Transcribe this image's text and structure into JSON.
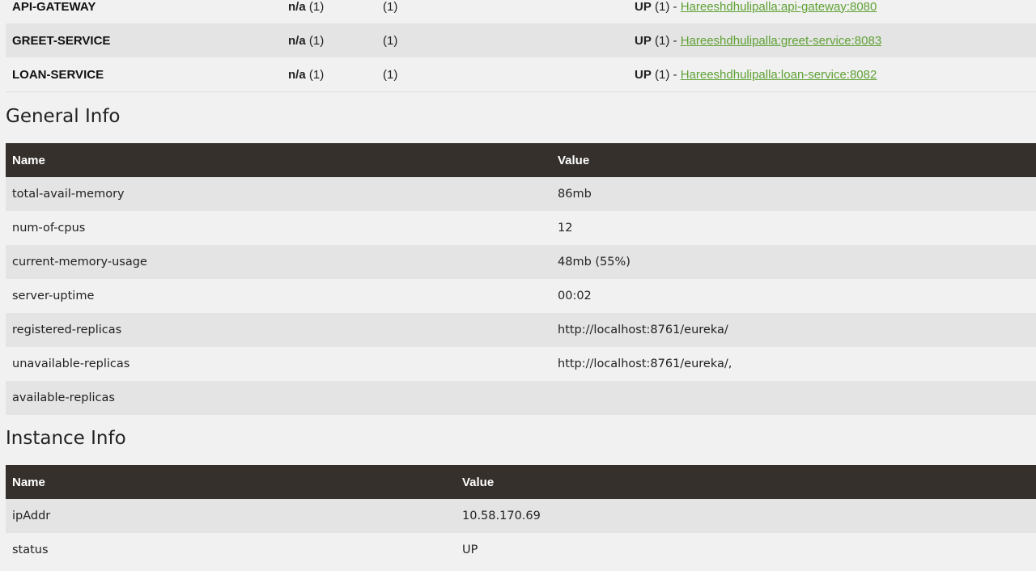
{
  "instances": [
    {
      "application": "API-GATEWAY",
      "ami_bold": "n/a",
      "ami_count": "(1)",
      "zones": "(1)",
      "status_prefix": "UP",
      "status_count": "(1) -",
      "status_link": "Hareeshdhulipalla:api-gateway:8080"
    },
    {
      "application": "GREET-SERVICE",
      "ami_bold": "n/a",
      "ami_count": "(1)",
      "zones": "(1)",
      "status_prefix": "UP",
      "status_count": "(1) -",
      "status_link": "Hareeshdhulipalla:greet-service:8083"
    },
    {
      "application": "LOAN-SERVICE",
      "ami_bold": "n/a",
      "ami_count": "(1)",
      "zones": "(1)",
      "status_prefix": "UP",
      "status_count": "(1) -",
      "status_link": "Hareeshdhulipalla:loan-service:8082"
    }
  ],
  "general_info": {
    "title": "General Info",
    "headers": {
      "name": "Name",
      "value": "Value"
    },
    "rows": [
      {
        "name": "total-avail-memory",
        "value": "86mb"
      },
      {
        "name": "num-of-cpus",
        "value": "12"
      },
      {
        "name": "current-memory-usage",
        "value": "48mb (55%)"
      },
      {
        "name": "server-uptime",
        "value": "00:02"
      },
      {
        "name": "registered-replicas",
        "value": "http://localhost:8761/eureka/"
      },
      {
        "name": "unavailable-replicas",
        "value": "http://localhost:8761/eureka/,"
      },
      {
        "name": "available-replicas",
        "value": ""
      }
    ]
  },
  "instance_info": {
    "title": "Instance Info",
    "headers": {
      "name": "Name",
      "value": "Value"
    },
    "rows": [
      {
        "name": "ipAddr",
        "value": "10.58.170.69"
      },
      {
        "name": "status",
        "value": "UP"
      }
    ]
  },
  "colors": {
    "header_bg": "#35302c",
    "link": "#5fa134",
    "row_alt": "#e4e4e4",
    "page_bg": "#f1f1f1"
  }
}
